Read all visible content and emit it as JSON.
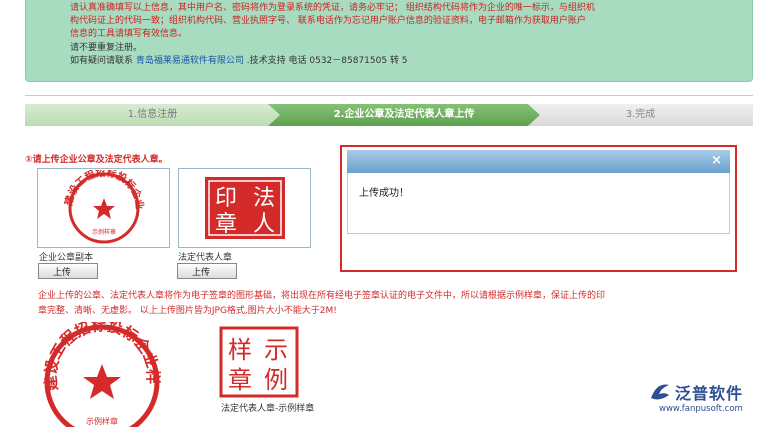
{
  "notice": {
    "line1": "请认真准确填写以上信息，其中用户名、密码将作为登录系统的凭证，请务必牢记；  组织结构代码将作为企业的唯一标示，与组织机",
    "line2": "构代码证上的代码一致；组织机构代码、营业执照字号、  联系电话作为忘记用户账户信息的验证资料，电子邮箱作为获取用户账户",
    "line3": "信息的工具请填写有效信息。",
    "line4": "请不要重复注册。",
    "contact_prefix": "如有疑问请联系",
    "company_link": "青岛福莱易通软件有限公司",
    "contact_suffix": ".技术支持  电话  0532－85871505 转  5"
  },
  "steps": [
    {
      "label": "1.信息注册"
    },
    {
      "label": "2.企业公章及法定代表人章上传"
    },
    {
      "label": "3.完成"
    }
  ],
  "upload": {
    "title": "①请上传企业公章及法定代表人章。",
    "company_seal_caption": "企业公章副本",
    "person_seal_caption": "法定代表人章",
    "upload_button": "上传",
    "note_line1": "企业上传的公章、法定代表人章将作为电子签章的图形基础，将出现在所有经电子签章认证的电子文件中，所以请根据示例样章，保证上传的印",
    "note_line2": "章完整、清晰、无虚影。  以上上传图片皆为JPG格式,图片大小不能大于2M!",
    "sample_person_caption": "法定代表人章-示例样章"
  },
  "seal_texts": {
    "company_arc": "建设工程招标投标企业样章",
    "company_footer": "示例样章",
    "person_chars": [
      "印",
      "法",
      "章",
      "人"
    ],
    "sample_chars": [
      "样",
      "示",
      "章",
      "例"
    ]
  },
  "dialog": {
    "close": "×",
    "message": "上传成功！"
  },
  "logo": {
    "name": "泛普软件",
    "url": "www.fanpusoft.com"
  },
  "colors": {
    "seal_red": "#d42a2a",
    "notice_bg": "#a8dcc0",
    "step_active": "#6aae5a",
    "dialog_header": "#6aa1cd"
  }
}
